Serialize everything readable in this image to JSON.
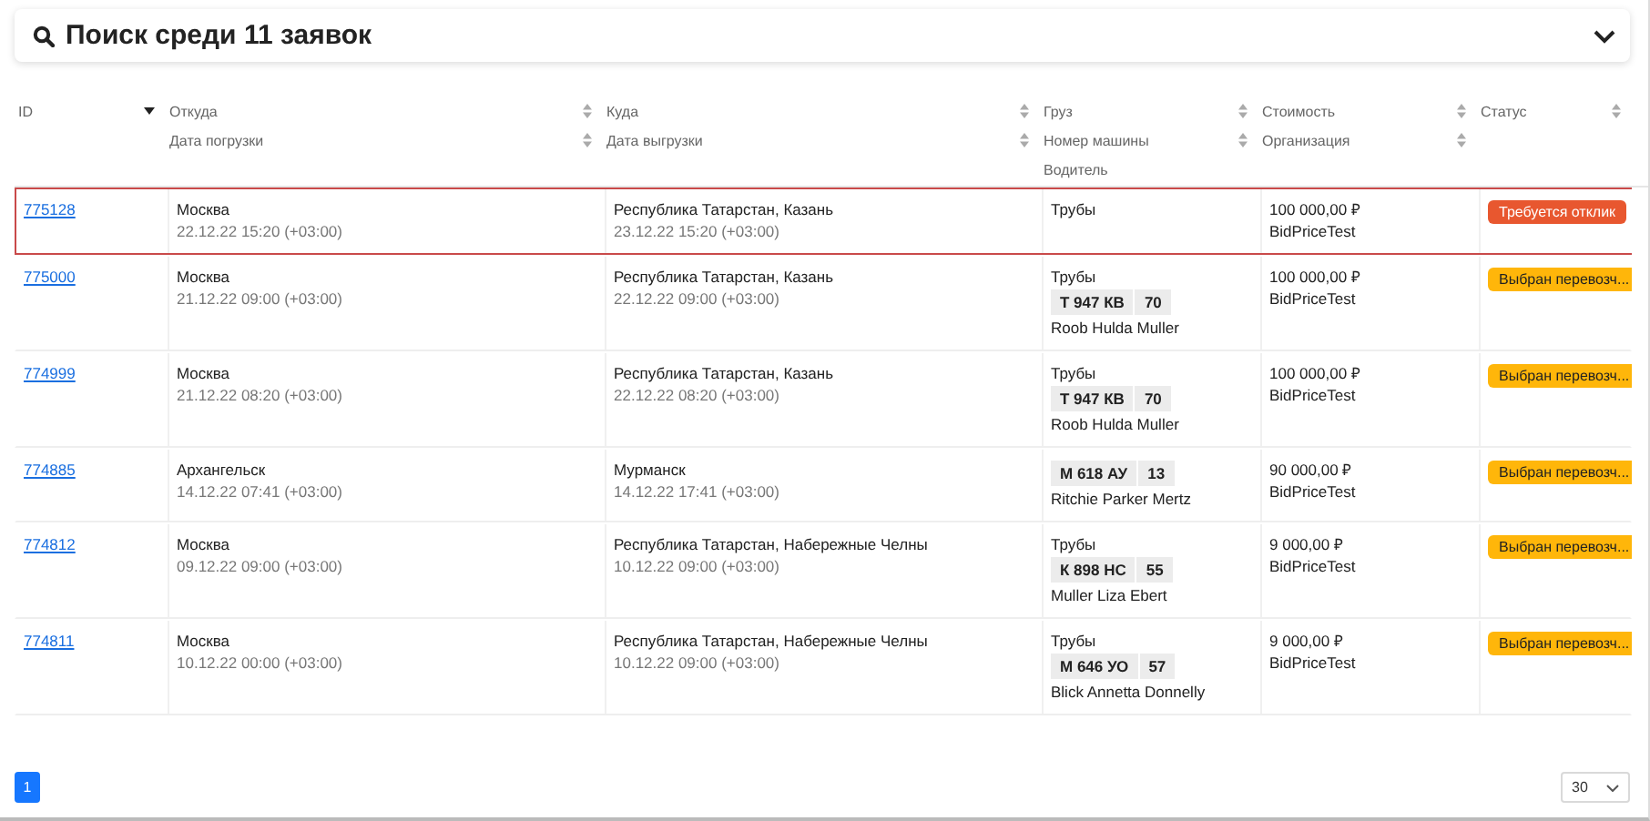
{
  "search": {
    "title": "Поиск среди 11 заявок",
    "expanded": false
  },
  "columns": [
    {
      "lines": [
        {
          "label": "ID",
          "sort_active": true
        }
      ]
    },
    {
      "lines": [
        {
          "label": "Откуда",
          "sort_active": false
        },
        {
          "label": "Дата погрузки",
          "sort_active": false
        }
      ]
    },
    {
      "lines": [
        {
          "label": "Куда",
          "sort_active": false
        },
        {
          "label": "Дата выгрузки",
          "sort_active": false
        }
      ]
    },
    {
      "lines": [
        {
          "label": "Груз",
          "sort_active": false
        },
        {
          "label": "Номер машины",
          "sort_active": false
        },
        {
          "label": "Водитель"
        }
      ]
    },
    {
      "lines": [
        {
          "label": "Стоимость",
          "sort_active": false
        },
        {
          "label": "Организация",
          "sort_active": false
        }
      ]
    },
    {
      "lines": [
        {
          "label": "Статус",
          "sort_active": false
        }
      ]
    }
  ],
  "rows": [
    {
      "id": "775128",
      "selected": true,
      "from": "Москва",
      "load_date": "22.12.22 15:20 (+03:00)",
      "to": "Республика Татарстан, Казань",
      "unload_date": "23.12.22 15:20 (+03:00)",
      "cargo": "Трубы",
      "cost": "100 000,00 ₽",
      "org": "BidPriceTest",
      "status": {
        "label": "Требуется отклик",
        "color": "#e8572f"
      }
    },
    {
      "id": "775000",
      "selected": false,
      "from": "Москва",
      "load_date": "21.12.22 09:00 (+03:00)",
      "to": "Республика Татарстан, Казань",
      "unload_date": "22.12.22 09:00 (+03:00)",
      "cargo": "Трубы",
      "plate": "Т 947 КВ",
      "region": "70",
      "driver": "Roob Hulda Muller",
      "cost": "100 000,00 ₽",
      "org": "BidPriceTest",
      "status": {
        "label": "Выбран перевозч...",
        "color": "#ffb60a"
      }
    },
    {
      "id": "774999",
      "selected": false,
      "from": "Москва",
      "load_date": "21.12.22 08:20 (+03:00)",
      "to": "Республика Татарстан, Казань",
      "unload_date": "22.12.22 08:20 (+03:00)",
      "cargo": "Трубы",
      "plate": "Т 947 КВ",
      "region": "70",
      "driver": "Roob Hulda Muller",
      "cost": "100 000,00 ₽",
      "org": "BidPriceTest",
      "status": {
        "label": "Выбран перевозч...",
        "color": "#ffb60a"
      }
    },
    {
      "id": "774885",
      "selected": false,
      "from": "Архангельск",
      "load_date": "14.12.22 07:41 (+03:00)",
      "to": "Мурманск",
      "unload_date": "14.12.22 17:41 (+03:00)",
      "plate": "М 618 АУ",
      "region": "13",
      "driver": "Ritchie Parker Mertz",
      "cost": "90 000,00 ₽",
      "org": "BidPriceTest",
      "status": {
        "label": "Выбран перевозч...",
        "color": "#ffb60a"
      }
    },
    {
      "id": "774812",
      "selected": false,
      "from": "Москва",
      "load_date": "09.12.22 09:00 (+03:00)",
      "to": "Республика Татарстан, Набережные Челны",
      "unload_date": "10.12.22 09:00 (+03:00)",
      "cargo": "Трубы",
      "plate": "К 898 НС",
      "region": "55",
      "driver": "Muller Liza Ebert",
      "cost": "9 000,00 ₽",
      "org": "BidPriceTest",
      "status": {
        "label": "Выбран перевозч...",
        "color": "#ffb60a"
      }
    },
    {
      "id": "774811",
      "selected": false,
      "from": "Москва",
      "load_date": "10.12.22 00:00 (+03:00)",
      "to": "Республика Татарстан, Набережные Челны",
      "unload_date": "10.12.22 09:00 (+03:00)",
      "cargo": "Трубы",
      "plate": "М 646 УО",
      "region": "57",
      "driver": "Blick Annetta Donnelly",
      "cost": "9 000,00 ₽",
      "org": "BidPriceTest",
      "status": {
        "label": "Выбран перевозч...",
        "color": "#ffb60a"
      }
    }
  ],
  "pagination": {
    "pages": [
      {
        "label": "1",
        "selected": true
      }
    ],
    "page_size": "30"
  }
}
